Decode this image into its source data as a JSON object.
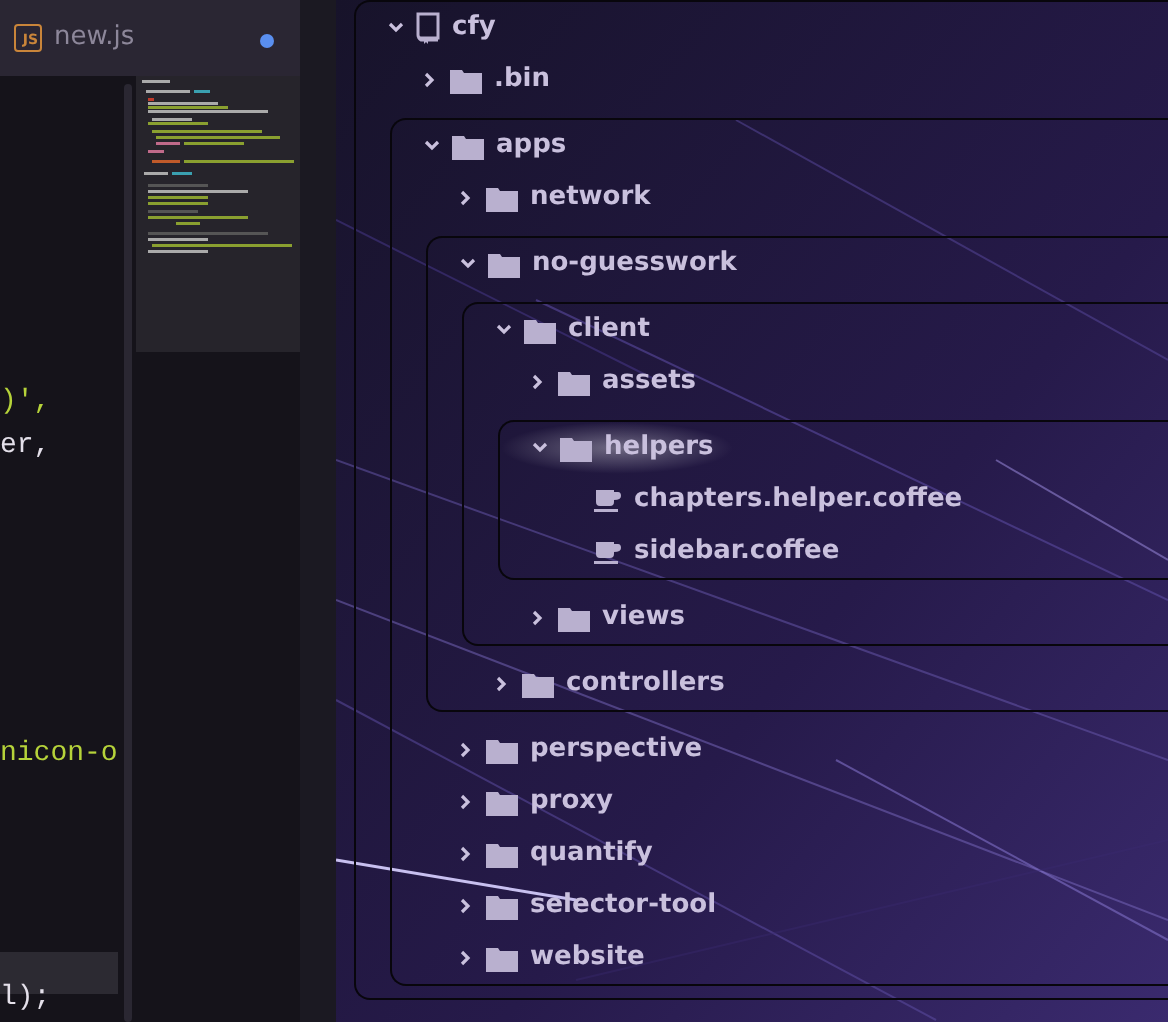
{
  "editor": {
    "tab": {
      "icon_text": "JS",
      "title": "new.js",
      "modified": true,
      "selected": true
    },
    "current_line_highlight": true,
    "lines": [
      {
        "text": ")',",
        "kind": "string"
      },
      {
        "text": "er,",
        "kind": "plain"
      },
      {
        "text": "nicon-o",
        "kind": "string"
      },
      {
        "text": "l);",
        "kind": "plain"
      }
    ]
  },
  "tree": {
    "name": "cfy",
    "kind": "root",
    "expanded": true,
    "selected": false,
    "children": [
      {
        "name": ".bin",
        "kind": "folder",
        "expanded": false,
        "selected": false
      },
      {
        "name": "apps",
        "kind": "folder",
        "expanded": true,
        "selected": false,
        "children": [
          {
            "name": "network",
            "kind": "folder",
            "expanded": false,
            "selected": false
          },
          {
            "name": "no-guesswork",
            "kind": "folder",
            "expanded": true,
            "selected": false,
            "children": [
              {
                "name": "client",
                "kind": "folder",
                "expanded": true,
                "selected": false,
                "children": [
                  {
                    "name": "assets",
                    "kind": "folder",
                    "expanded": false,
                    "selected": false
                  },
                  {
                    "name": "helpers",
                    "kind": "folder",
                    "expanded": true,
                    "selected": true,
                    "children": [
                      {
                        "name": "chapters.helper.coffee",
                        "kind": "file",
                        "selected": false
                      },
                      {
                        "name": "sidebar.coffee",
                        "kind": "file",
                        "selected": false
                      }
                    ]
                  },
                  {
                    "name": "views",
                    "kind": "folder",
                    "expanded": false,
                    "selected": false
                  }
                ]
              },
              {
                "name": "controllers",
                "kind": "folder",
                "expanded": false,
                "selected": false
              }
            ]
          },
          {
            "name": "perspective",
            "kind": "folder",
            "expanded": false,
            "selected": false
          },
          {
            "name": "proxy",
            "kind": "folder",
            "expanded": false,
            "selected": false
          },
          {
            "name": "quantify",
            "kind": "folder",
            "expanded": false,
            "selected": false
          },
          {
            "name": "selector-tool",
            "kind": "folder",
            "expanded": false,
            "selected": false
          },
          {
            "name": "website",
            "kind": "folder",
            "expanded": false,
            "selected": false
          }
        ]
      }
    ]
  }
}
